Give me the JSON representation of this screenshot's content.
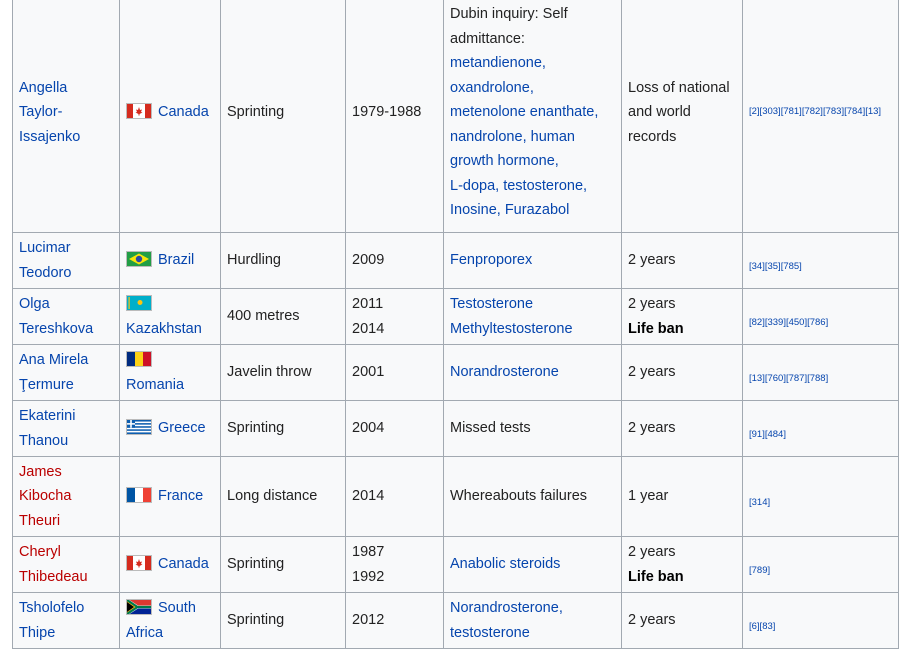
{
  "rows": [
    {
      "name": "Angella Taylor-Issajenko",
      "name_red": false,
      "flag": "canada-flag",
      "country": "Canada",
      "event": "Sprinting",
      "years": [
        "1979-1988"
      ],
      "substance_plain": "Dubin inquiry: Self admittance:",
      "substances": [
        "metandienone,",
        "oxandrolone,",
        "metenolone enanthate,",
        "nandrolone,",
        "human growth hormone,",
        "L-dopa,",
        "testosterone,",
        "Inosine,",
        "Furazabol"
      ],
      "penalty": [
        "Loss of national and world records"
      ],
      "refs": "[2][303][781][782][783][784][13]"
    },
    {
      "name": "Lucimar Teodoro",
      "name_red": false,
      "flag": "brazil-flag",
      "country": "Brazil",
      "event": "Hurdling",
      "years": [
        "2009"
      ],
      "substances": [
        "Fenproporex"
      ],
      "penalty": [
        "2 years"
      ],
      "refs": "[34][35][785]"
    },
    {
      "name": "Olga Tereshkova",
      "name_red": false,
      "flag": "kazakhstan-flag",
      "country": "Kazakhstan",
      "event": "400 metres",
      "years": [
        "2011",
        "2014"
      ],
      "substances": [
        "Testosterone",
        "Methyltestosterone"
      ],
      "penalty": [
        "2 years",
        "Life ban"
      ],
      "refs": "[82][339][450][786]"
    },
    {
      "name": "Ana Mirela Ţermure",
      "name_red": false,
      "flag": "romania-flag",
      "country": "Romania",
      "event": "Javelin throw",
      "years": [
        "2001"
      ],
      "substances": [
        "Norandrosterone"
      ],
      "penalty": [
        "2 years"
      ],
      "refs": "[13][760][787][788]"
    },
    {
      "name": "Ekaterini Thanou",
      "name_red": false,
      "flag": "greece-flag",
      "country": "Greece",
      "event": "Sprinting",
      "years": [
        "2004"
      ],
      "substance_plain": "Missed tests",
      "penalty": [
        "2 years"
      ],
      "refs": "[91][484]"
    },
    {
      "name": "James Kibocha Theuri",
      "name_red": true,
      "flag": "france-flag",
      "country": "France",
      "event": "Long distance",
      "years": [
        "2014"
      ],
      "substance_plain": "Whereabouts failures",
      "penalty": [
        "1 year"
      ],
      "refs": "[314]"
    },
    {
      "name": "Cheryl Thibedeau",
      "name_red": true,
      "flag": "canada-flag",
      "country": "Canada",
      "event": "Sprinting",
      "years": [
        "1987",
        "1992"
      ],
      "substances": [
        "Anabolic steroids"
      ],
      "penalty": [
        "2 years",
        "Life ban"
      ],
      "refs": "[789]"
    },
    {
      "name": "Tsholofelo Thipe",
      "name_red": false,
      "flag": "south-africa-flag",
      "country": "South Africa",
      "event": "Sprinting",
      "years": [
        "2012"
      ],
      "substances": [
        "Norandrosterone,",
        "testosterone"
      ],
      "penalty": [
        "2 years"
      ],
      "refs": "[6][83]"
    }
  ]
}
